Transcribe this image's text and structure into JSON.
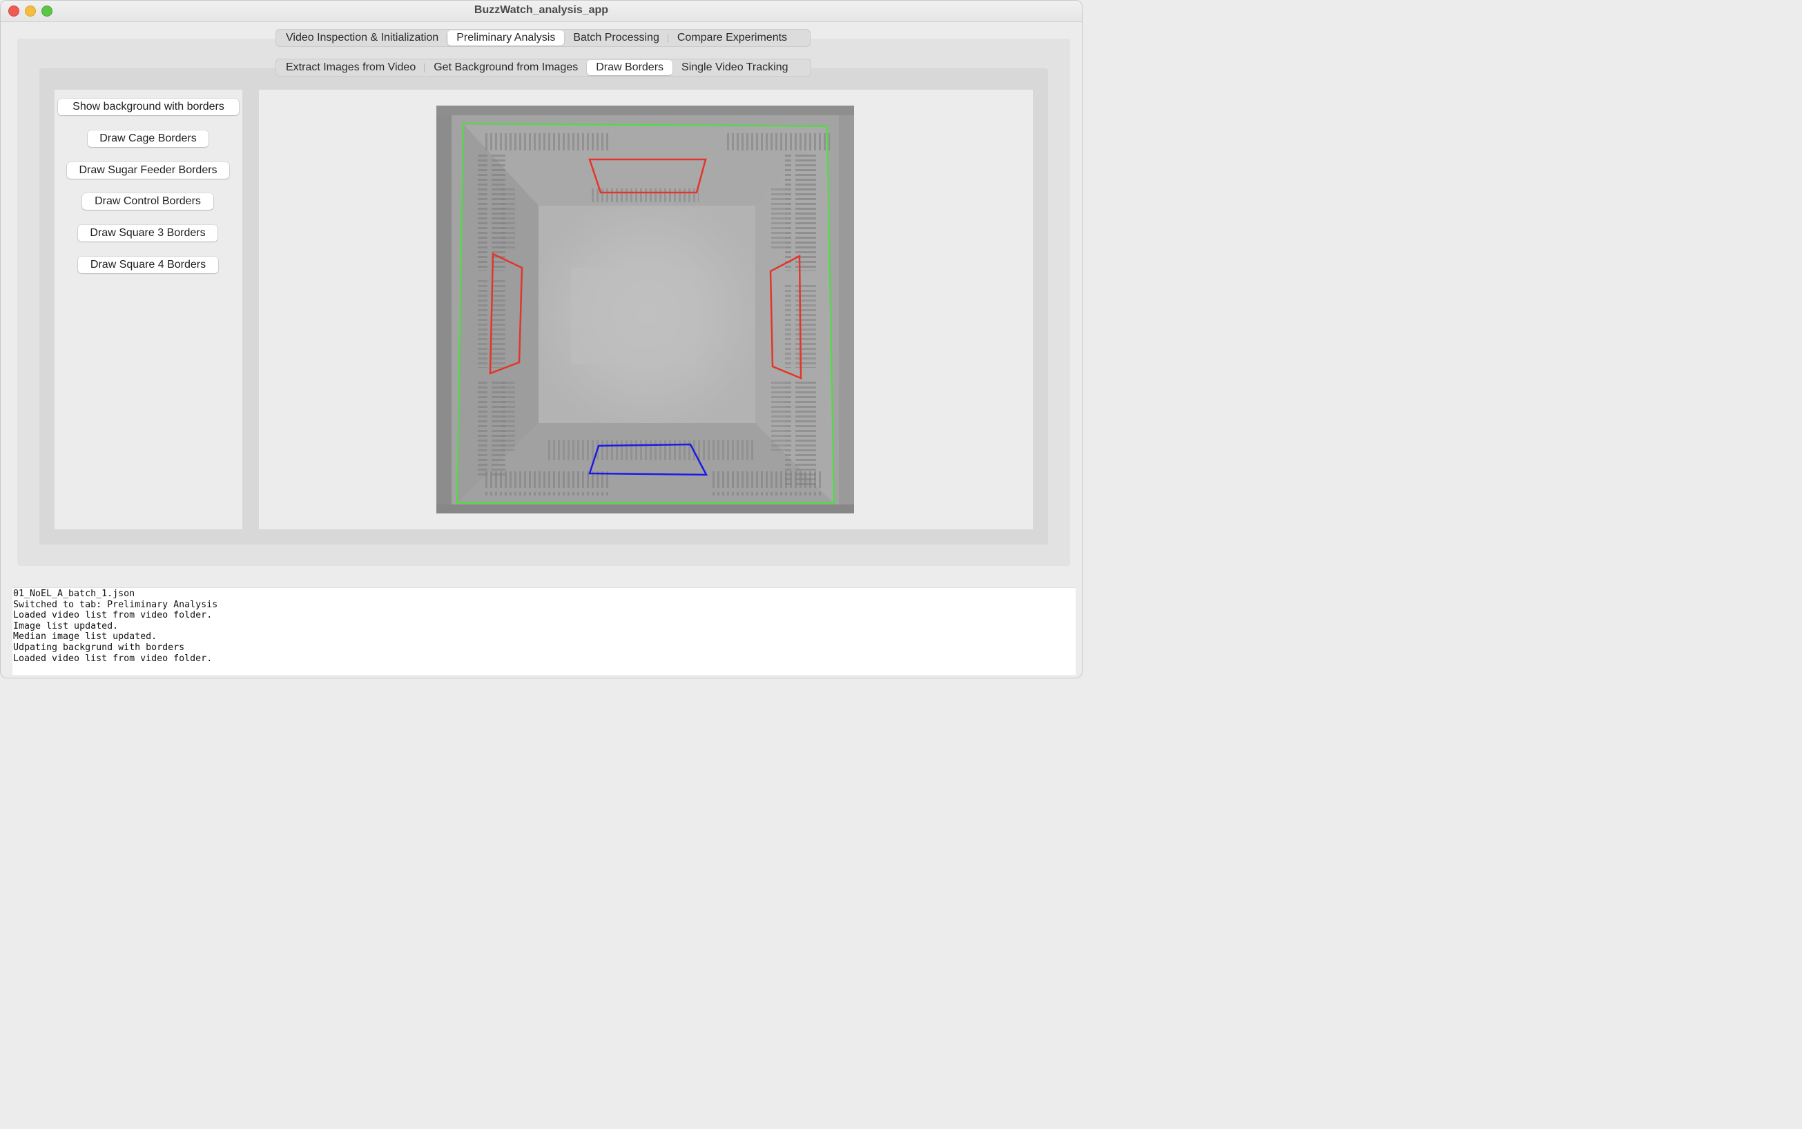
{
  "window": {
    "title": "BuzzWatch_analysis_app"
  },
  "main_tabs": [
    {
      "label": "Video Inspection & Initialization",
      "active": false
    },
    {
      "label": "Preliminary Analysis",
      "active": true
    },
    {
      "label": "Batch Processing",
      "active": false
    },
    {
      "label": "Compare Experiments",
      "active": false
    }
  ],
  "sub_tabs": [
    {
      "label": "Extract Images from Video",
      "active": false
    },
    {
      "label": "Get Background from Images",
      "active": false
    },
    {
      "label": "Draw Borders",
      "active": true
    },
    {
      "label": "Single Video Tracking",
      "active": false
    }
  ],
  "buttons": {
    "show_background": "Show background with borders",
    "cage": "Draw Cage Borders",
    "sugar_feeder": "Draw Sugar Feeder Borders",
    "control": "Draw Control Borders",
    "square3": "Draw Square 3 Borders",
    "square4": "Draw Square 4 Borders"
  },
  "borders": {
    "cage_color": "#47e23a",
    "feeder_color": "#e3352a",
    "control_color": "#1a1ae8"
  },
  "log": [
    "01_NoEL_A_batch_1.json",
    "Switched to tab: Preliminary Analysis",
    "Loaded video list from video folder.",
    "Image list updated.",
    "Median image list updated.",
    "Udpating backgrund with borders",
    "Loaded video list from video folder."
  ]
}
